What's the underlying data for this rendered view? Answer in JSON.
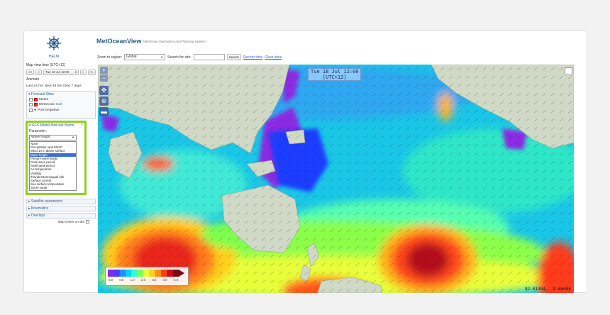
{
  "app": {
    "logo_text": "HELM",
    "title": "MetOceanView",
    "subtitle": "MetOcean Operations and Planning System"
  },
  "sidebar": {
    "map_view_time_label": "Map view time [UTC+12]",
    "nav_first": "<<",
    "nav_prev": "<",
    "date_value": "Tue 18 Jul 12:00",
    "nav_next": ">",
    "nav_last": ">>",
    "animate_label": "Animate:",
    "range_24": "Last 24 hrs",
    "range_48": "Next 48 hrs",
    "range_7d": "Next 7 days",
    "forecast_sites_head": "Forecast Sites",
    "sites": [
      {
        "name": "Metes"
      },
      {
        "name": "MetOcean",
        "extra": "Edit"
      },
      {
        "name": "Port longwave"
      }
    ],
    "gfs_head": "GFS Model forecast charts",
    "gfs_help": "?",
    "parameter_label": "Parameter:",
    "parameter_value": "Wave height",
    "parameter_options": [
      "None",
      "Precipitation and MSLP",
      "Wind 10 m above surface",
      "Wave height",
      "Primary swell height",
      "Peak wave period",
      "Swell peak period",
      "Air temperature",
      "Visibility",
      "Thunderstorm/squall risk",
      "Surface current",
      "Sea surface temperature",
      "Storm surge"
    ],
    "selected_option_index": 3,
    "satellite_head": "Satellite parameters",
    "kinematics_head": "Kinematics",
    "overlays_head": "Overlays",
    "map_center_label": "Map center on site"
  },
  "toolbar": {
    "zoom_label": "Zoom to region:",
    "zoom_value": "Global",
    "search_label": "Search for site:",
    "search_placeholder": "",
    "search_button": "Search",
    "recent_sites": "Recent sites",
    "clear_sites": "Clear sites"
  },
  "map": {
    "timestamp_line1": "Tue 18 Jul 12:00",
    "timestamp_line2": "[UTC+12]",
    "zoom_in": "+",
    "zoom_out": "−",
    "coords": "82.01384, -9.66686"
  },
  "legend": {
    "ticks": [
      "0.0",
      "0.5",
      "1.0",
      "2.0",
      "3.0",
      "4.0",
      "6.0"
    ],
    "colors": [
      "#8a2be2",
      "#4b3cff",
      "#1e90ff",
      "#00d4ff",
      "#33ffcc",
      "#7dff4d",
      "#e6ff33",
      "#ffd11a",
      "#ff8c1a",
      "#ff3b1a",
      "#c8101a",
      "#7a0a14"
    ]
  },
  "colors": {
    "accent": "#2a5c8a",
    "highlight": "#8fd124",
    "selected": "#3b6fd1"
  }
}
